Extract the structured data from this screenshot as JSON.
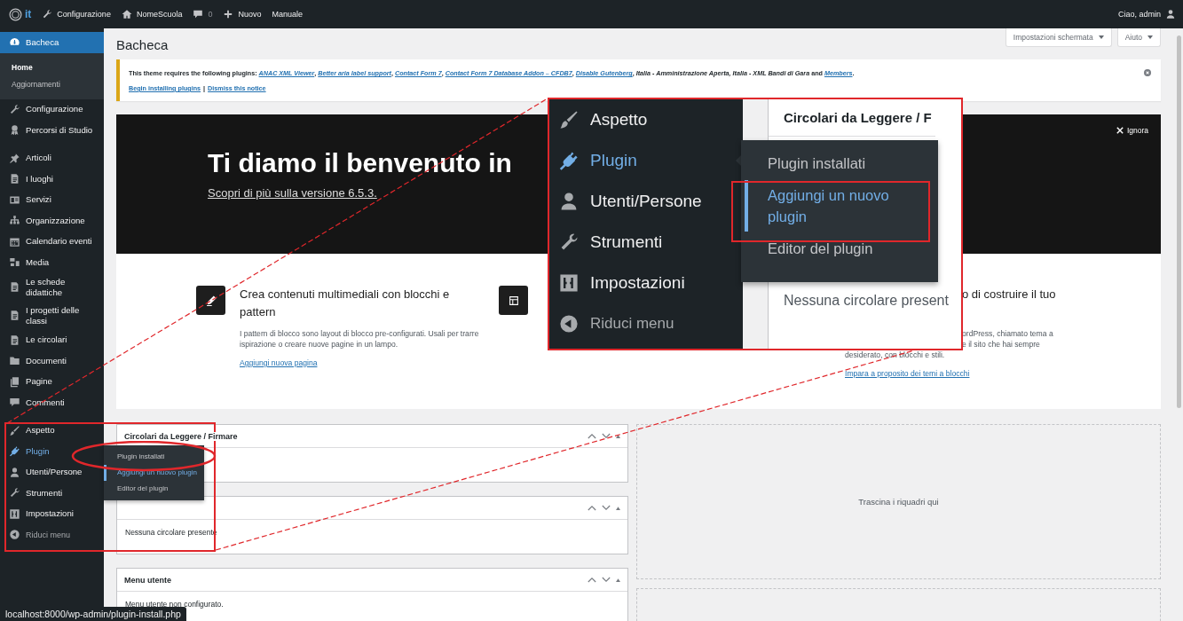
{
  "admin_bar": {
    "logo_text": "it",
    "items": [
      "Configurazione",
      "NomeScuola",
      "0",
      "Nuovo",
      "Manuale"
    ],
    "account": "Ciao, admin"
  },
  "sidebar": {
    "groups": [
      {
        "items": [
          {
            "label": "Bacheca",
            "kind": "menu",
            "selected": true,
            "open": false,
            "children": [
              {
                "label": "Home",
                "selected": true
              },
              {
                "label": "Aggiornamenti",
                "selected": false
              }
            ]
          },
          {
            "label": "Configurazione",
            "kind": "menu",
            "selected": false,
            "open": false
          },
          {
            "label": "Percorsi di Studio",
            "kind": "menu",
            "selected": false,
            "open": false
          }
        ]
      },
      {
        "items": [
          {
            "label": "Articoli",
            "kind": "menu",
            "selected": false,
            "open": false
          },
          {
            "label": "I luoghi",
            "kind": "menu",
            "selected": false,
            "open": false
          },
          {
            "label": "Servizi",
            "kind": "menu",
            "selected": false,
            "open": false
          },
          {
            "label": "Organizzazione",
            "kind": "menu",
            "selected": false,
            "open": false
          },
          {
            "label": "Calendario eventi",
            "kind": "menu",
            "selected": false,
            "open": false
          },
          {
            "label": "Media",
            "kind": "menu",
            "selected": false,
            "open": false
          },
          {
            "label": "Le schede didattiche",
            "kind": "menu",
            "selected": false,
            "open": false
          },
          {
            "label": "I progetti delle classi",
            "kind": "menu",
            "selected": false,
            "open": false
          },
          {
            "label": "Le circolari",
            "kind": "menu",
            "selected": false,
            "open": false
          },
          {
            "label": "Documenti",
            "kind": "menu",
            "selected": false,
            "open": false
          },
          {
            "label": "Pagine",
            "kind": "menu",
            "selected": false,
            "open": false
          },
          {
            "label": "Commenti",
            "kind": "menu",
            "selected": false,
            "open": false
          }
        ]
      },
      {
        "items": [
          {
            "label": "Aspetto",
            "kind": "menu",
            "selected": false,
            "open": false
          },
          {
            "label": "Plugin",
            "kind": "menu",
            "selected": false,
            "open": true,
            "children": [
              {
                "label": "Plugin installati",
                "selected": false
              },
              {
                "label": "Aggiungi un nuovo plugin",
                "selected": true
              },
              {
                "label": "Editor del plugin",
                "selected": false
              }
            ]
          },
          {
            "label": "Utenti/Persone",
            "kind": "menu",
            "selected": false,
            "open": false
          },
          {
            "label": "Strumenti",
            "kind": "menu",
            "selected": false,
            "open": false
          },
          {
            "label": "Impostazioni",
            "kind": "menu",
            "selected": false,
            "open": false
          },
          {
            "label": "Riduci menu",
            "kind": "collapse",
            "selected": false,
            "open": false
          }
        ]
      }
    ]
  },
  "screen_buttons": [
    "Impostazioni schermata",
    "Aiuto"
  ],
  "page_title": "Bacheca",
  "notice": {
    "parts": [
      {
        "kind": "text",
        "text": "This theme requires the following plugins: "
      },
      {
        "kind": "link",
        "text": "ANAC XML Viewer"
      },
      {
        "kind": "text",
        "text": ", "
      },
      {
        "kind": "link",
        "text": "Better aria label support"
      },
      {
        "kind": "text",
        "text": ", "
      },
      {
        "kind": "link",
        "text": "Contact Form 7"
      },
      {
        "kind": "text",
        "text": ", "
      },
      {
        "kind": "link",
        "text": "Contact Form 7 Database Addon – CFDB7"
      },
      {
        "kind": "text",
        "text": ", "
      },
      {
        "kind": "link",
        "text": "Disable Gutenberg"
      },
      {
        "kind": "text",
        "text": ", "
      },
      {
        "kind": "italic",
        "text": "Italia - Amministrazione Aperta, Italia - XML Bandi di Gara"
      },
      {
        "kind": "text",
        "text": " and "
      },
      {
        "kind": "link",
        "text": "Members"
      },
      {
        "kind": "text",
        "text": "."
      }
    ],
    "actions": [
      "Begin installing plugins",
      "Dismiss this notice"
    ],
    "separator": "|"
  },
  "welcome": {
    "dismiss": "Ignora",
    "title": "Ti diamo il benvenuto in",
    "version_link": "Scopri di più sulla versione 6.5.3.",
    "columns": [
      {
        "kind": "full",
        "title": "Crea contenuti multimediali con blocchi e pattern",
        "text": "I pattern di blocco sono layout di blocco pre-configurati. Usali per trarre ispirazione o creare nuove pagine in un lampo.",
        "link": "Aggiungi nuova pagina"
      },
      {
        "kind": "icon_only"
      },
      {
        "kind": "partial",
        "title": "o di costruire il tuo",
        "lines": [
          "ordPress, chiamato tema a",
          "e il sito che hai sempre",
          "desiderato, con blocchi e stili."
        ],
        "link": "Impara a proposito dei temi a blocchi"
      }
    ]
  },
  "widgets": [
    {
      "title": "Circolari da Leggere / Firmare"
    },
    {
      "body": "Nessuna circolare presente"
    },
    {
      "title": "Menu utente",
      "body": "Menu utente non configurato."
    }
  ],
  "drop_zone": "Trascina i riquadri qui",
  "inset": {
    "menu": [
      {
        "label": "Aspetto",
        "kind": "menu",
        "open": false
      },
      {
        "label": "Plugin",
        "kind": "menu",
        "open": true
      },
      {
        "label": "Utenti/Persone",
        "kind": "menu",
        "open": false
      },
      {
        "label": "Strumenti",
        "kind": "menu",
        "open": false
      },
      {
        "label": "Impostazioni",
        "kind": "menu",
        "open": false
      },
      {
        "label": "Riduci menu",
        "kind": "collapse",
        "open": false
      }
    ],
    "flyout": [
      {
        "label": "Plugin installati",
        "selected": false
      },
      {
        "label": "Aggiungi un nuovo plugin",
        "selected": true
      },
      {
        "label": "Editor del plugin",
        "selected": false
      }
    ],
    "card_title": "Circolari da Leggere / F",
    "card_text": "Nessuna circolare present"
  },
  "status_bar": {
    "url": "localhost:8000/wp-admin/plugin-install.php"
  }
}
